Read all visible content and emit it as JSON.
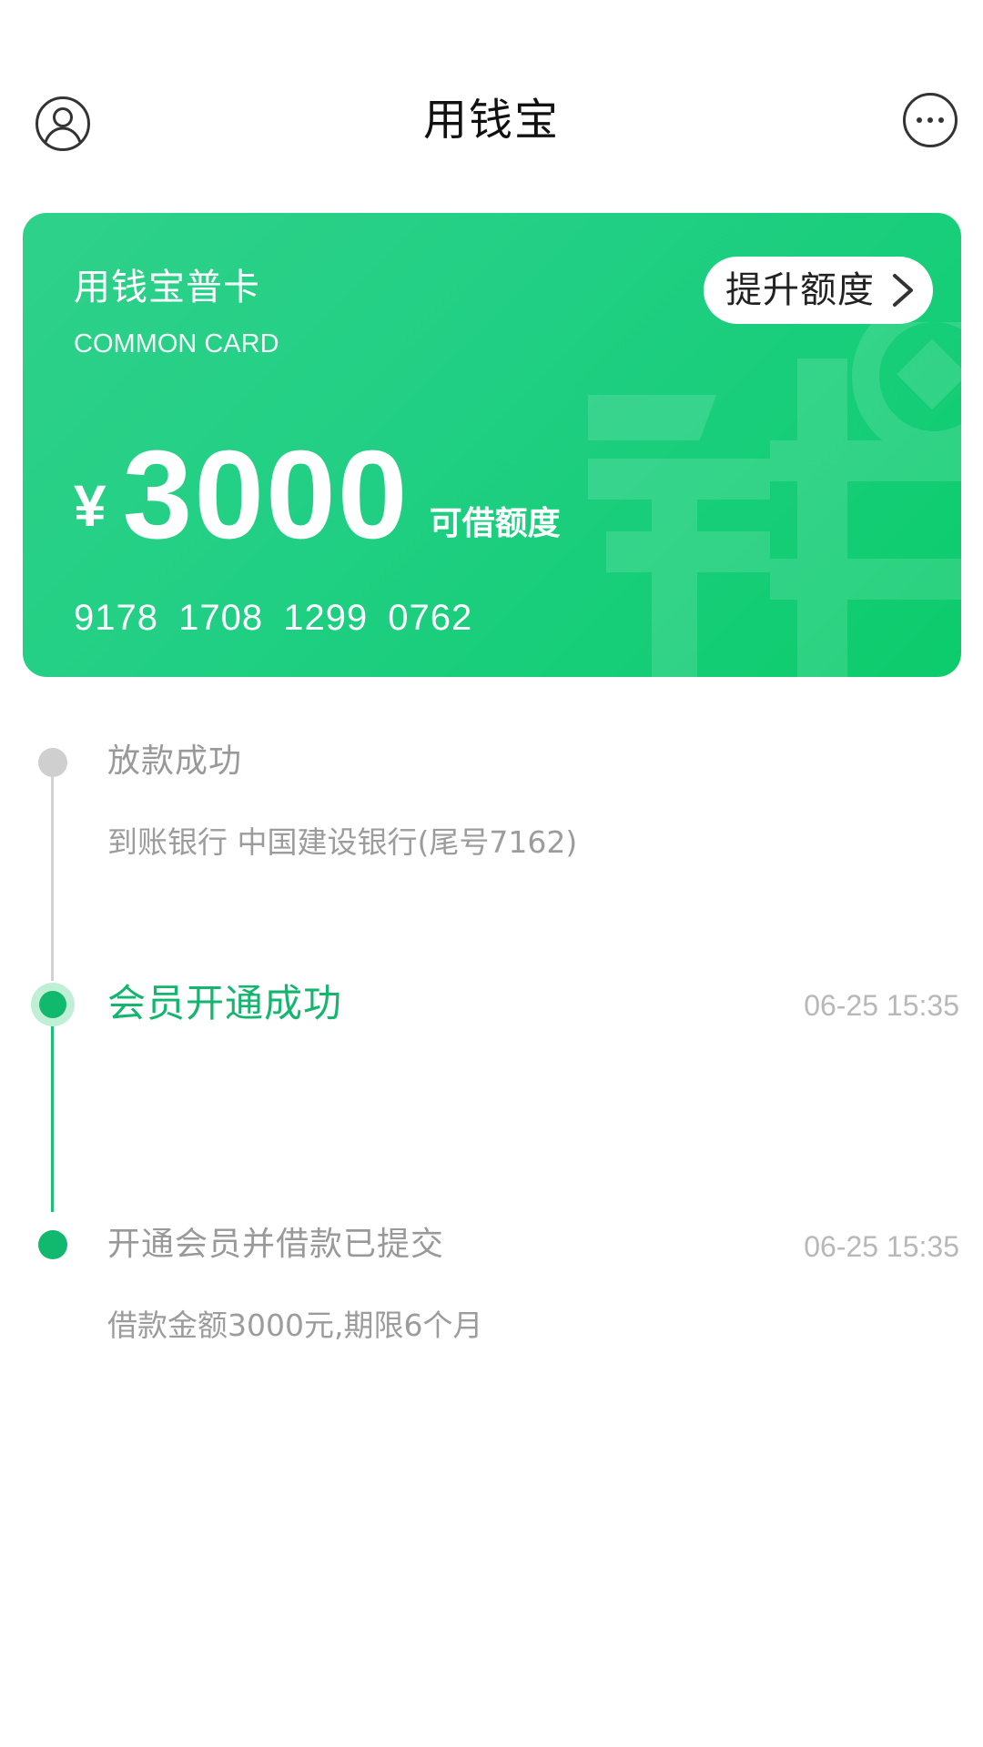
{
  "header": {
    "title": "用钱宝",
    "left_icon": "user-profile-icon",
    "right_icon": "more-options-icon"
  },
  "card": {
    "title": "用钱宝普卡",
    "subtitle": "COMMON CARD",
    "upgrade_label": "提升额度",
    "currency": "¥",
    "amount": "3000",
    "amount_label": "可借额度",
    "card_number": "9178  1708  1299  0762",
    "watermark_icon": "qian-watermark-icon",
    "gradient_start": "#2fd18a",
    "gradient_end": "#0ccc6c"
  },
  "timeline": {
    "accent_color": "#13b56f",
    "items": [
      {
        "title": "放款成功",
        "time": "",
        "desc": "到账银行 中国建设银行(尾号7162)",
        "state": "pending"
      },
      {
        "title": "会员开通成功",
        "time": "06-25 15:35",
        "desc": "",
        "state": "active"
      },
      {
        "title": "开通会员并借款已提交",
        "time": "06-25 15:35",
        "desc": "借款金额3000元,期限6个月",
        "state": "done"
      }
    ]
  }
}
